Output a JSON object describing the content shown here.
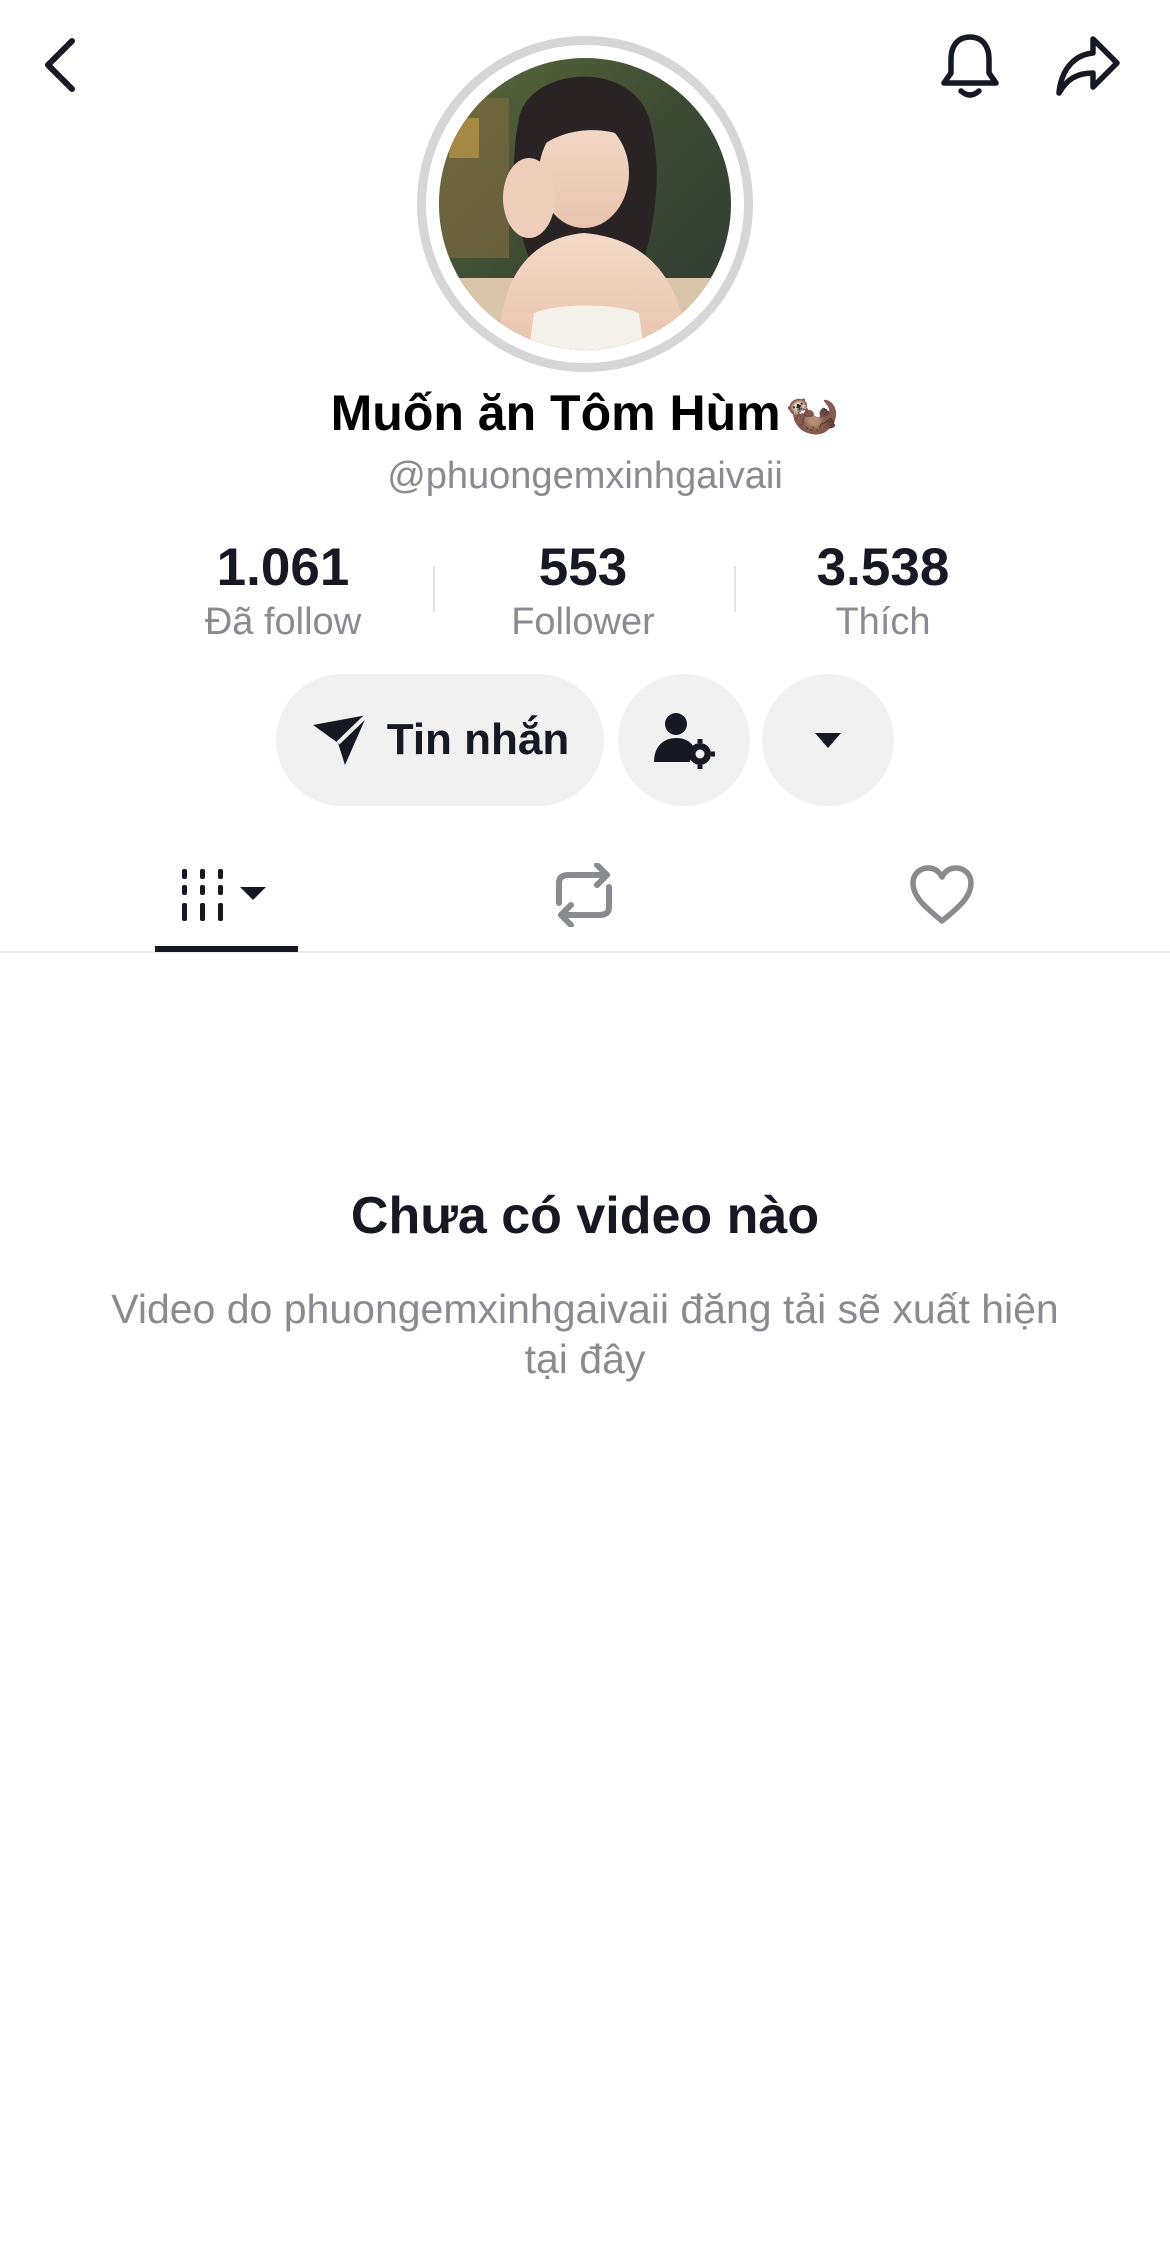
{
  "header": {
    "back_icon": "chevron-left-icon",
    "notification_icon": "bell-icon",
    "share_icon": "share-arrow-icon"
  },
  "profile": {
    "display_name": "Muốn ăn Tôm Hùm",
    "display_name_emoji": "🦦",
    "username": "@phuongemxinhgaivaii",
    "avatar": "profile-photo"
  },
  "stats": [
    {
      "value": "1.061",
      "label": "Đã follow"
    },
    {
      "value": "553",
      "label": "Follower"
    },
    {
      "value": "3.538",
      "label": "Thích"
    }
  ],
  "actions": {
    "message_label": "Tin nhắn",
    "message_icon": "send-icon",
    "friend_settings_icon": "user-gear-icon",
    "more_icon": "caret-down-icon"
  },
  "tabs": [
    {
      "name": "videos",
      "icon": "video-grid-icon",
      "active": true
    },
    {
      "name": "reposts",
      "icon": "repost-icon",
      "active": false
    },
    {
      "name": "liked",
      "icon": "heart-icon",
      "active": false
    }
  ],
  "empty_state": {
    "title": "Chưa có video nào",
    "description": "Video do phuongemxinhgaivaii đăng tải sẽ xuất hiện tại đây"
  },
  "colors": {
    "primary_text": "#161823",
    "secondary_text": "#8a8b91",
    "button_bg": "#f1f1f2",
    "avatar_ring": "#d6d6d8"
  }
}
